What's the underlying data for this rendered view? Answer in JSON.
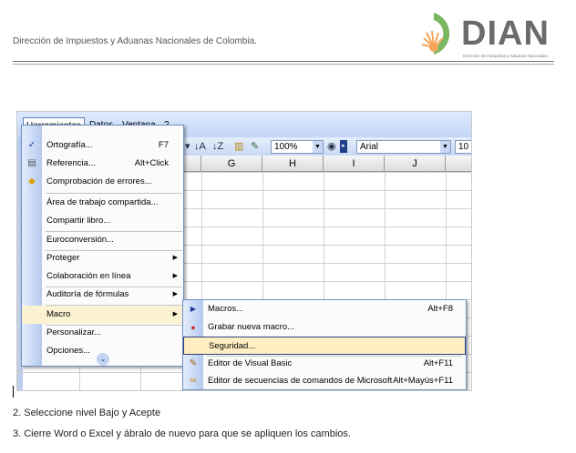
{
  "header": {
    "org_text": "Dirección de Impuestos y Aduanas Nacionales de Colombia.",
    "logo_word": "DIAN",
    "logo_subtext": "Dirección de Impuestos y Aduanas Nacionales",
    "logo_color": "#6b6b6b",
    "logo_accent": "#f5a45a"
  },
  "excel": {
    "menubar": [
      "Herramientas",
      "Datos",
      "Ventana",
      "?"
    ],
    "toolbar": {
      "zoom": "100%",
      "font": "Arial",
      "font_size": "10"
    },
    "columns": [
      "G",
      "H",
      "I",
      "J"
    ],
    "menu": {
      "items": [
        {
          "label": "Ortografía...",
          "shortcut": "F7",
          "icon": "spellcheck-icon"
        },
        {
          "label": "Referencia...",
          "shortcut": "Alt+Click",
          "icon": "research-icon"
        },
        {
          "label": "Comprobación de errores...",
          "shortcut": "",
          "icon": "error-check-icon"
        },
        {
          "label": "Área de trabajo compartida...",
          "shortcut": ""
        },
        {
          "label": "Compartir libro...",
          "shortcut": ""
        },
        {
          "label": "Euroconversión...",
          "shortcut": ""
        },
        {
          "label": "Proteger",
          "shortcut": "",
          "submenu": true
        },
        {
          "label": "Colaboración en línea",
          "shortcut": "",
          "submenu": true
        },
        {
          "label": "Auditoría de fórmulas",
          "shortcut": "",
          "submenu": true
        },
        {
          "label": "Macro",
          "shortcut": "",
          "submenu": true,
          "highlighted": true
        },
        {
          "label": "Personalizar...",
          "shortcut": ""
        },
        {
          "label": "Opciones...",
          "shortcut": ""
        }
      ]
    },
    "submenu": {
      "items": [
        {
          "label": "Macros...",
          "shortcut": "Alt+F8",
          "icon": "play-icon"
        },
        {
          "label": "Grabar nueva macro...",
          "shortcut": "",
          "icon": "record-icon"
        },
        {
          "label": "Seguridad...",
          "shortcut": "",
          "highlighted": true
        },
        {
          "label": "Editor de Visual Basic",
          "shortcut": "Alt+F11",
          "icon": "vb-editor-icon"
        },
        {
          "label": "Editor de secuencias de comandos de Microsoft",
          "shortcut": "Alt+Mayús+F11",
          "icon": "script-editor-icon"
        }
      ]
    }
  },
  "steps": {
    "step2_prefix": "2. Seleccione nivel ",
    "step2_bold": "Bajo",
    "step2_suffix": " y Acepte",
    "step3": "3. Cierre Word o Excel y ábralo de nuevo para que se apliquen los cambios."
  }
}
